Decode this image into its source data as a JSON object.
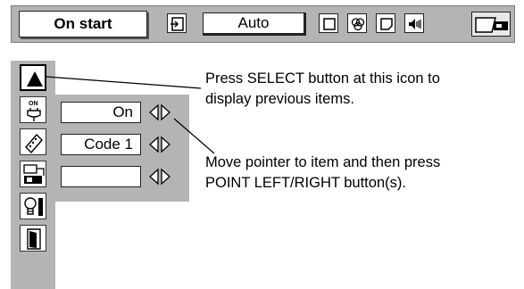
{
  "toolbar": {
    "title": "On start",
    "mode_value": "Auto",
    "icons": [
      "input-icon",
      "picture-icon",
      "image-adjust-icon",
      "screen-icon",
      "sound-icon",
      "setting-icon"
    ]
  },
  "menu": {
    "icons": [
      "previous-items-arrow-icon",
      "power-on-icon",
      "remote-code-icon",
      "projector-icon",
      "lamp-icon",
      "exit-icon"
    ]
  },
  "items": [
    {
      "value": "On"
    },
    {
      "value": "Code 1"
    },
    {
      "value": ""
    }
  ],
  "callouts": {
    "select_line1": "Press SELECT button at this icon to",
    "select_line2": "display previous items.",
    "pointer_line1": "Move pointer to item and then press",
    "pointer_line2": "POINT LEFT/RIGHT button(s)."
  },
  "colors": {
    "panel_gray": "#b4b4b4",
    "field_white": "#ffffff"
  }
}
